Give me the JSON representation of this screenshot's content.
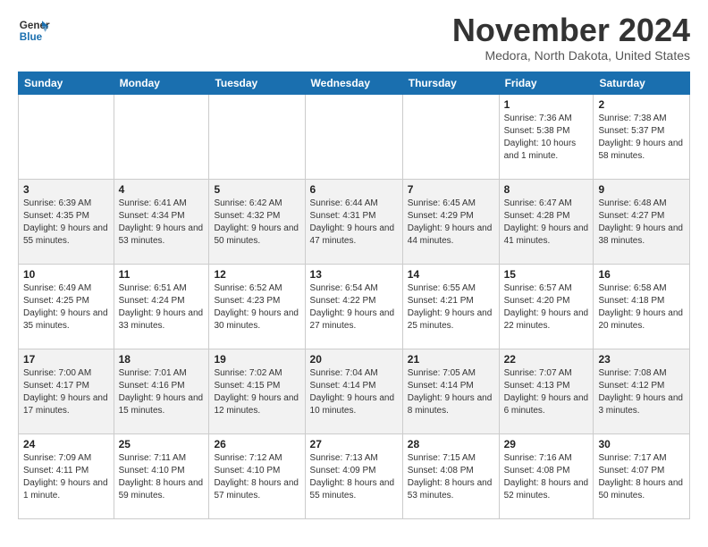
{
  "logo": {
    "text_general": "General",
    "text_blue": "Blue"
  },
  "header": {
    "month": "November 2024",
    "location": "Medora, North Dakota, United States"
  },
  "weekdays": [
    "Sunday",
    "Monday",
    "Tuesday",
    "Wednesday",
    "Thursday",
    "Friday",
    "Saturday"
  ],
  "weeks": [
    [
      {
        "day": "",
        "info": ""
      },
      {
        "day": "",
        "info": ""
      },
      {
        "day": "",
        "info": ""
      },
      {
        "day": "",
        "info": ""
      },
      {
        "day": "",
        "info": ""
      },
      {
        "day": "1",
        "info": "Sunrise: 7:36 AM\nSunset: 5:38 PM\nDaylight: 10 hours and 1 minute."
      },
      {
        "day": "2",
        "info": "Sunrise: 7:38 AM\nSunset: 5:37 PM\nDaylight: 9 hours and 58 minutes."
      }
    ],
    [
      {
        "day": "3",
        "info": "Sunrise: 6:39 AM\nSunset: 4:35 PM\nDaylight: 9 hours and 55 minutes."
      },
      {
        "day": "4",
        "info": "Sunrise: 6:41 AM\nSunset: 4:34 PM\nDaylight: 9 hours and 53 minutes."
      },
      {
        "day": "5",
        "info": "Sunrise: 6:42 AM\nSunset: 4:32 PM\nDaylight: 9 hours and 50 minutes."
      },
      {
        "day": "6",
        "info": "Sunrise: 6:44 AM\nSunset: 4:31 PM\nDaylight: 9 hours and 47 minutes."
      },
      {
        "day": "7",
        "info": "Sunrise: 6:45 AM\nSunset: 4:29 PM\nDaylight: 9 hours and 44 minutes."
      },
      {
        "day": "8",
        "info": "Sunrise: 6:47 AM\nSunset: 4:28 PM\nDaylight: 9 hours and 41 minutes."
      },
      {
        "day": "9",
        "info": "Sunrise: 6:48 AM\nSunset: 4:27 PM\nDaylight: 9 hours and 38 minutes."
      }
    ],
    [
      {
        "day": "10",
        "info": "Sunrise: 6:49 AM\nSunset: 4:25 PM\nDaylight: 9 hours and 35 minutes."
      },
      {
        "day": "11",
        "info": "Sunrise: 6:51 AM\nSunset: 4:24 PM\nDaylight: 9 hours and 33 minutes."
      },
      {
        "day": "12",
        "info": "Sunrise: 6:52 AM\nSunset: 4:23 PM\nDaylight: 9 hours and 30 minutes."
      },
      {
        "day": "13",
        "info": "Sunrise: 6:54 AM\nSunset: 4:22 PM\nDaylight: 9 hours and 27 minutes."
      },
      {
        "day": "14",
        "info": "Sunrise: 6:55 AM\nSunset: 4:21 PM\nDaylight: 9 hours and 25 minutes."
      },
      {
        "day": "15",
        "info": "Sunrise: 6:57 AM\nSunset: 4:20 PM\nDaylight: 9 hours and 22 minutes."
      },
      {
        "day": "16",
        "info": "Sunrise: 6:58 AM\nSunset: 4:18 PM\nDaylight: 9 hours and 20 minutes."
      }
    ],
    [
      {
        "day": "17",
        "info": "Sunrise: 7:00 AM\nSunset: 4:17 PM\nDaylight: 9 hours and 17 minutes."
      },
      {
        "day": "18",
        "info": "Sunrise: 7:01 AM\nSunset: 4:16 PM\nDaylight: 9 hours and 15 minutes."
      },
      {
        "day": "19",
        "info": "Sunrise: 7:02 AM\nSunset: 4:15 PM\nDaylight: 9 hours and 12 minutes."
      },
      {
        "day": "20",
        "info": "Sunrise: 7:04 AM\nSunset: 4:14 PM\nDaylight: 9 hours and 10 minutes."
      },
      {
        "day": "21",
        "info": "Sunrise: 7:05 AM\nSunset: 4:14 PM\nDaylight: 9 hours and 8 minutes."
      },
      {
        "day": "22",
        "info": "Sunrise: 7:07 AM\nSunset: 4:13 PM\nDaylight: 9 hours and 6 minutes."
      },
      {
        "day": "23",
        "info": "Sunrise: 7:08 AM\nSunset: 4:12 PM\nDaylight: 9 hours and 3 minutes."
      }
    ],
    [
      {
        "day": "24",
        "info": "Sunrise: 7:09 AM\nSunset: 4:11 PM\nDaylight: 9 hours and 1 minute."
      },
      {
        "day": "25",
        "info": "Sunrise: 7:11 AM\nSunset: 4:10 PM\nDaylight: 8 hours and 59 minutes."
      },
      {
        "day": "26",
        "info": "Sunrise: 7:12 AM\nSunset: 4:10 PM\nDaylight: 8 hours and 57 minutes."
      },
      {
        "day": "27",
        "info": "Sunrise: 7:13 AM\nSunset: 4:09 PM\nDaylight: 8 hours and 55 minutes."
      },
      {
        "day": "28",
        "info": "Sunrise: 7:15 AM\nSunset: 4:08 PM\nDaylight: 8 hours and 53 minutes."
      },
      {
        "day": "29",
        "info": "Sunrise: 7:16 AM\nSunset: 4:08 PM\nDaylight: 8 hours and 52 minutes."
      },
      {
        "day": "30",
        "info": "Sunrise: 7:17 AM\nSunset: 4:07 PM\nDaylight: 8 hours and 50 minutes."
      }
    ]
  ]
}
